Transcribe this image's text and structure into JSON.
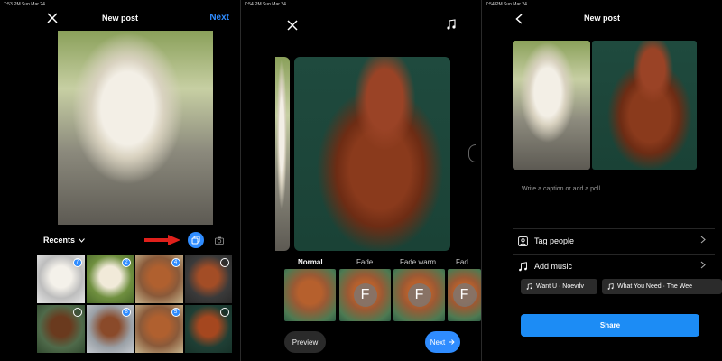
{
  "screen1": {
    "status_time": "7:53 PM",
    "status_date": "Sun Mar 24",
    "title": "New post",
    "next_label": "Next",
    "recents_label": "Recents",
    "selection_badges": [
      "7",
      "2",
      "4",
      "",
      "",
      "6",
      "5",
      ""
    ]
  },
  "screen2": {
    "status_time": "7:54 PM",
    "status_date": "Sun Mar 24",
    "filters": [
      "Normal",
      "Fade",
      "Fade warm",
      "Fad"
    ],
    "filter_thumb_letter": "F",
    "preview_label": "Preview",
    "next_label": "Next"
  },
  "screen3": {
    "status_time": "7:54 PM",
    "status_date": "Sun Mar 24",
    "title": "New post",
    "caption_placeholder": "Write a caption or add a poll...",
    "tag_people_label": "Tag people",
    "add_music_label": "Add music",
    "music_chips": [
      "Want U · Noevdv",
      "What You Need · The Wee"
    ],
    "share_label": "Share"
  },
  "colors": {
    "accent": "#2f8cff",
    "share_button": "#1c8cf5",
    "arrow": "#e0201b"
  }
}
